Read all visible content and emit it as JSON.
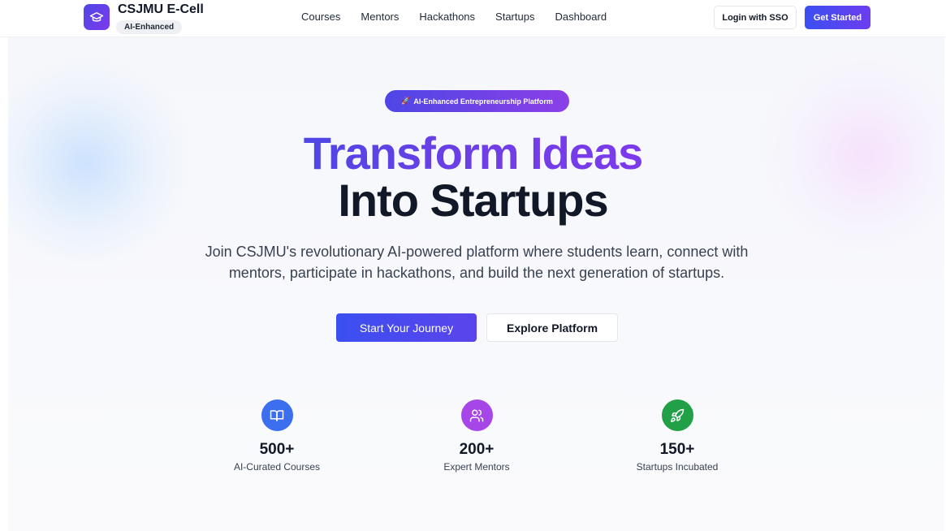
{
  "header": {
    "brand_name": "CSJMU E-Cell",
    "brand_badge": "AI-Enhanced",
    "nav": [
      "Courses",
      "Mentors",
      "Hackathons",
      "Startups",
      "Dashboard"
    ],
    "login_label": "Login with SSO",
    "get_started_label": "Get Started"
  },
  "hero": {
    "pill_icon": "🚀",
    "pill_label": "AI-Enhanced Entrepreneurship Platform",
    "title_line1": "Transform Ideas",
    "title_line2": "Into Startups",
    "subtitle": "Join CSJMU's revolutionary AI-powered platform where students learn, connect with mentors, participate in hackathons, and build the next generation of startups.",
    "primary_cta": "Start Your Journey",
    "secondary_cta": "Explore Platform"
  },
  "stats": [
    {
      "icon": "book-open-icon",
      "color": "#3b6ff0",
      "value": "500+",
      "label": "AI-Curated Courses"
    },
    {
      "icon": "users-icon",
      "color": "#a646e8",
      "value": "200+",
      "label": "Expert Mentors"
    },
    {
      "icon": "rocket-icon",
      "color": "#22a048",
      "value": "150+",
      "label": "Startups Incubated"
    }
  ],
  "colors": {
    "primary": "#4f46e5",
    "accent": "#7c3aed",
    "text": "#111827"
  }
}
